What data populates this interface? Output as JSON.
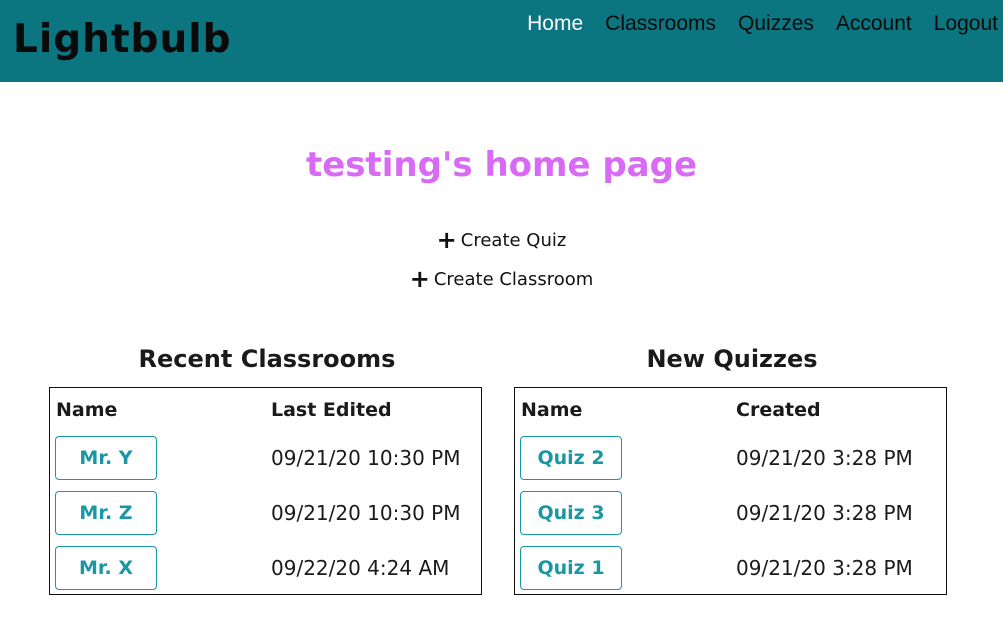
{
  "brand": "Lightbulb",
  "nav": {
    "items": [
      {
        "label": "Home",
        "active": true
      },
      {
        "label": "Classrooms",
        "active": false
      },
      {
        "label": "Quizzes",
        "active": false
      },
      {
        "label": "Account",
        "active": false
      },
      {
        "label": "Logout",
        "active": false
      }
    ]
  },
  "page_title": "testing's home page",
  "actions": {
    "create_quiz": "Create Quiz",
    "create_classroom": "Create Classroom"
  },
  "recent_classrooms": {
    "title": "Recent Classrooms",
    "headers": {
      "name": "Name",
      "date": "Last Edited"
    },
    "rows": [
      {
        "name": "Mr. Y",
        "date": "09/21/20 10:30 PM"
      },
      {
        "name": "Mr. Z",
        "date": "09/21/20 10:30 PM"
      },
      {
        "name": "Mr. X",
        "date": "09/22/20 4:24 AM"
      }
    ]
  },
  "new_quizzes": {
    "title": "New Quizzes",
    "headers": {
      "name": "Name",
      "date": "Created"
    },
    "rows": [
      {
        "name": "Quiz 2",
        "date": "09/21/20 3:28 PM"
      },
      {
        "name": "Quiz 3",
        "date": "09/21/20 3:28 PM"
      },
      {
        "name": "Quiz 1",
        "date": "09/21/20 3:28 PM"
      }
    ]
  },
  "colors": {
    "navbar": "#0b7580",
    "title": "#d96af5",
    "accent": "#1a97a5"
  },
  "icons": {
    "action": "plus-icon"
  }
}
